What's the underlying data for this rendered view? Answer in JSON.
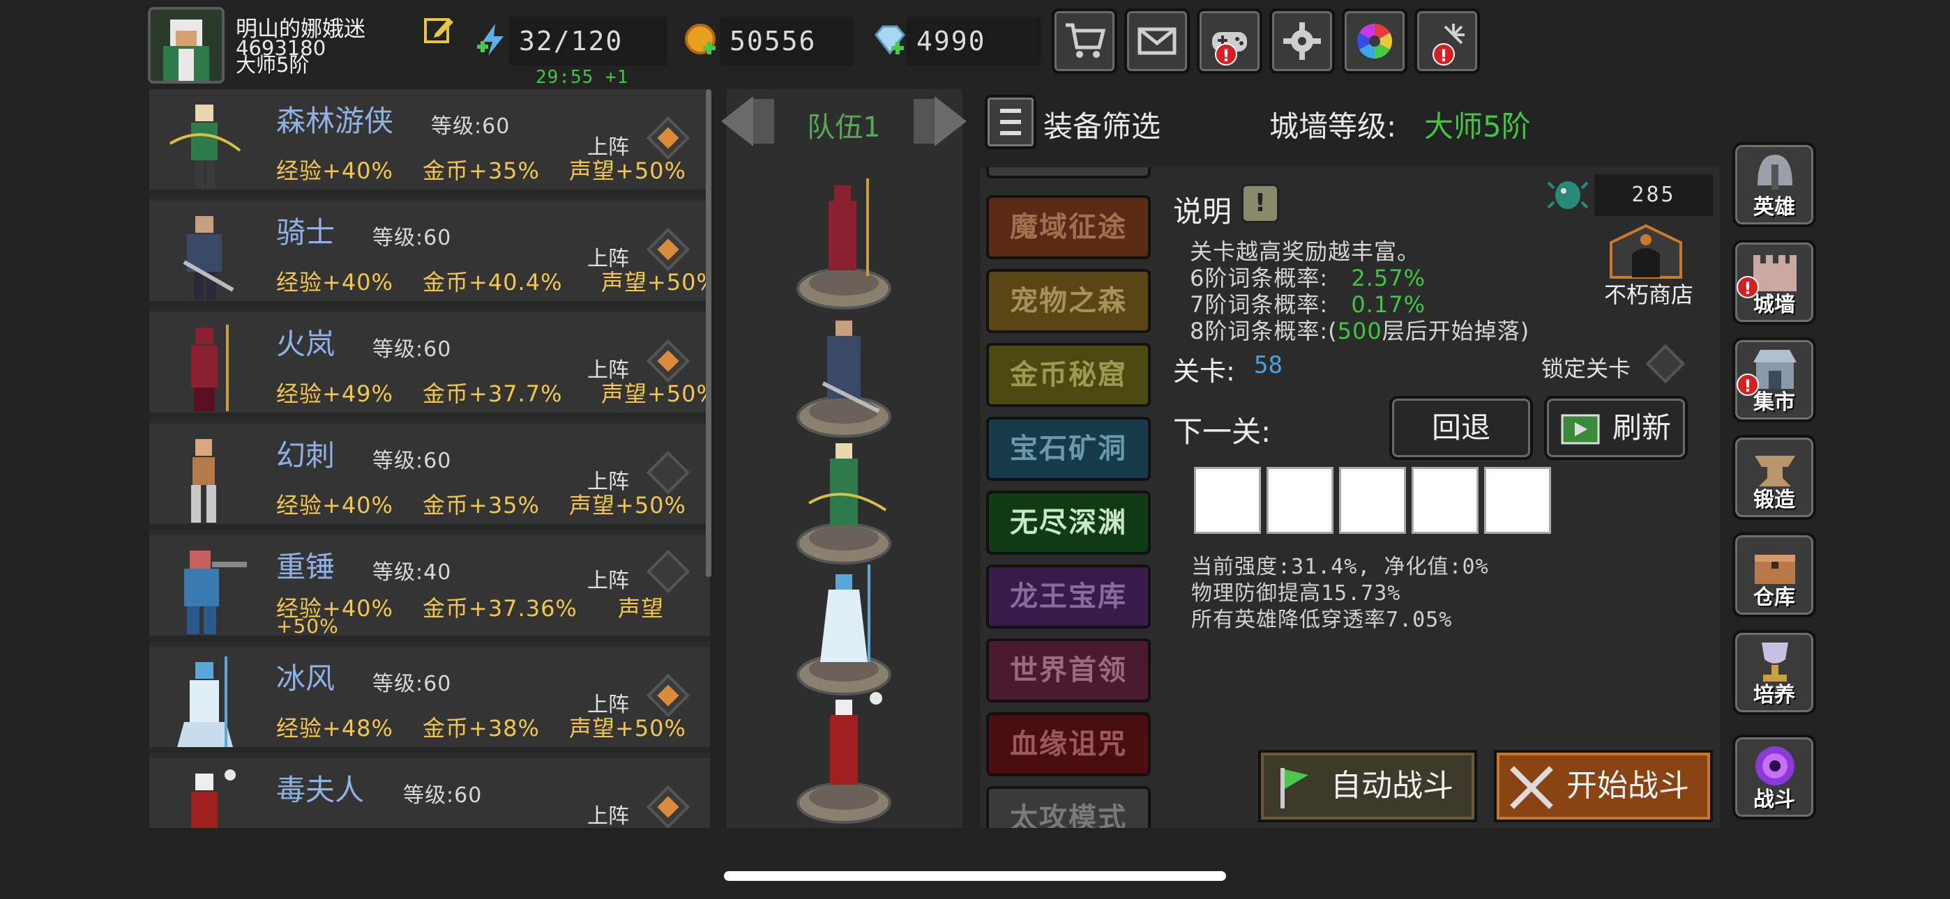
{
  "player": {
    "name": "明山的娜娥迷",
    "id": "4693180",
    "rank": "大师5阶"
  },
  "resources": {
    "energy": "32/120",
    "energy_timer": "29:55 +1",
    "gold": "50556",
    "gems": "4990"
  },
  "top_buttons": [
    {
      "icon": "cart-icon",
      "alert": false
    },
    {
      "icon": "mail-icon",
      "alert": false
    },
    {
      "icon": "gamepad-icon",
      "alert": true
    },
    {
      "icon": "gear-icon",
      "alert": false
    },
    {
      "icon": "color-wheel-icon",
      "alert": false
    },
    {
      "icon": "firework-icon",
      "alert": true
    }
  ],
  "heroes": [
    {
      "name": "森林游侠",
      "level": "等级:60",
      "exp": "经验+40%",
      "gold": "金币+35%",
      "fame": "声望+50%",
      "deploy": "上阵",
      "deployed": true,
      "color": "#2e7a4a"
    },
    {
      "name": "骑士",
      "level": "等级:60",
      "exp": "经验+40%",
      "gold": "金币+40.4%",
      "fame": "声望+50%",
      "deploy": "上阵",
      "deployed": true,
      "color": "#3a4a66"
    },
    {
      "name": "火岚",
      "level": "等级:60",
      "exp": "经验+49%",
      "gold": "金币+37.7%",
      "fame": "声望+50%",
      "deploy": "上阵",
      "deployed": true,
      "color": "#8a2030"
    },
    {
      "name": "幻刺",
      "level": "等级:60",
      "exp": "经验+40%",
      "gold": "金币+35%",
      "fame": "声望+50%",
      "deploy": "上阵",
      "deployed": false,
      "color": "#b07a4a"
    },
    {
      "name": "重锤",
      "level": "等级:40",
      "exp": "经验+40%",
      "gold": "金币+37.36%",
      "fame": "声望",
      "fame2": "+50%",
      "deploy": "上阵",
      "deployed": false,
      "color": "#3a7ab0"
    },
    {
      "name": "冰风",
      "level": "等级:60",
      "exp": "经验+48%",
      "gold": "金币+38%",
      "fame": "声望+50%",
      "deploy": "上阵",
      "deployed": true,
      "color": "#5aa8d8"
    },
    {
      "name": "毒夫人",
      "level": "等级:60",
      "exp": "",
      "gold": "",
      "fame": "",
      "deploy": "上阵",
      "deployed": true,
      "color": "#a02020"
    }
  ],
  "team": {
    "label": "队伍1"
  },
  "header": {
    "filter": "装备筛选",
    "wall_label": "城墙等级:",
    "wall_value": "大师5阶"
  },
  "modes": [
    {
      "label": "魔域征途",
      "bg": "#5a2a14",
      "fg": "#a07050"
    },
    {
      "label": "宠物之森",
      "bg": "#5a4614",
      "fg": "#a8905a"
    },
    {
      "label": "金币秘窟",
      "bg": "#4a4a10",
      "fg": "#9a9a50"
    },
    {
      "label": "宝石矿洞",
      "bg": "#163a4a",
      "fg": "#6a9aaa"
    },
    {
      "label": "无尽深渊",
      "bg": "#0f3a12",
      "fg": "#c8e8c8"
    },
    {
      "label": "龙王宝库",
      "bg": "#3a1a4a",
      "fg": "#8a6aa0"
    },
    {
      "label": "世界首领",
      "bg": "#4a1a30",
      "fg": "#9a6a80"
    },
    {
      "label": "血缘诅咒",
      "bg": "#4a0e0e",
      "fg": "#9a5a5a"
    },
    {
      "label": "太攻模式",
      "bg": "#3a3a3a",
      "fg": "#7a7a7a"
    }
  ],
  "info": {
    "title": "说明",
    "help": "!",
    "line1": "关卡越高奖励越丰富。",
    "line2_label": "6阶词条概率:",
    "line2_value": "2.57%",
    "line3_label": "7阶词条概率:",
    "line3_value": "0.17%",
    "line4_a": "8阶词条概率:(",
    "line4_b": "500",
    "line4_c": "层后开始掉落)",
    "gem_count": "285",
    "shop_label": "不朽商店"
  },
  "stage": {
    "label": "关卡:",
    "value": "58",
    "lock_label": "锁定关卡",
    "next_label": "下一关:",
    "back_label": "回退",
    "refresh_label": "刷新"
  },
  "stats": {
    "line1": "当前强度:31.4%, 净化值:0%",
    "line2": "物理防御提高15.73%",
    "line3": "所有英雄降低穿透率7.05%"
  },
  "battle": {
    "auto": "自动战斗",
    "start": "开始战斗"
  },
  "side_nav": [
    {
      "label": "英雄",
      "icon": "helmet-icon",
      "alert": false
    },
    {
      "label": "城墙",
      "icon": "wall-icon",
      "alert": true
    },
    {
      "label": "集市",
      "icon": "market-icon",
      "alert": true
    },
    {
      "label": "锻造",
      "icon": "anvil-icon",
      "alert": false
    },
    {
      "label": "仓库",
      "icon": "storage-icon",
      "alert": false
    },
    {
      "label": "培养",
      "icon": "trophy-icon",
      "alert": false
    },
    {
      "label": "战斗",
      "icon": "portal-icon",
      "alert": false
    }
  ]
}
